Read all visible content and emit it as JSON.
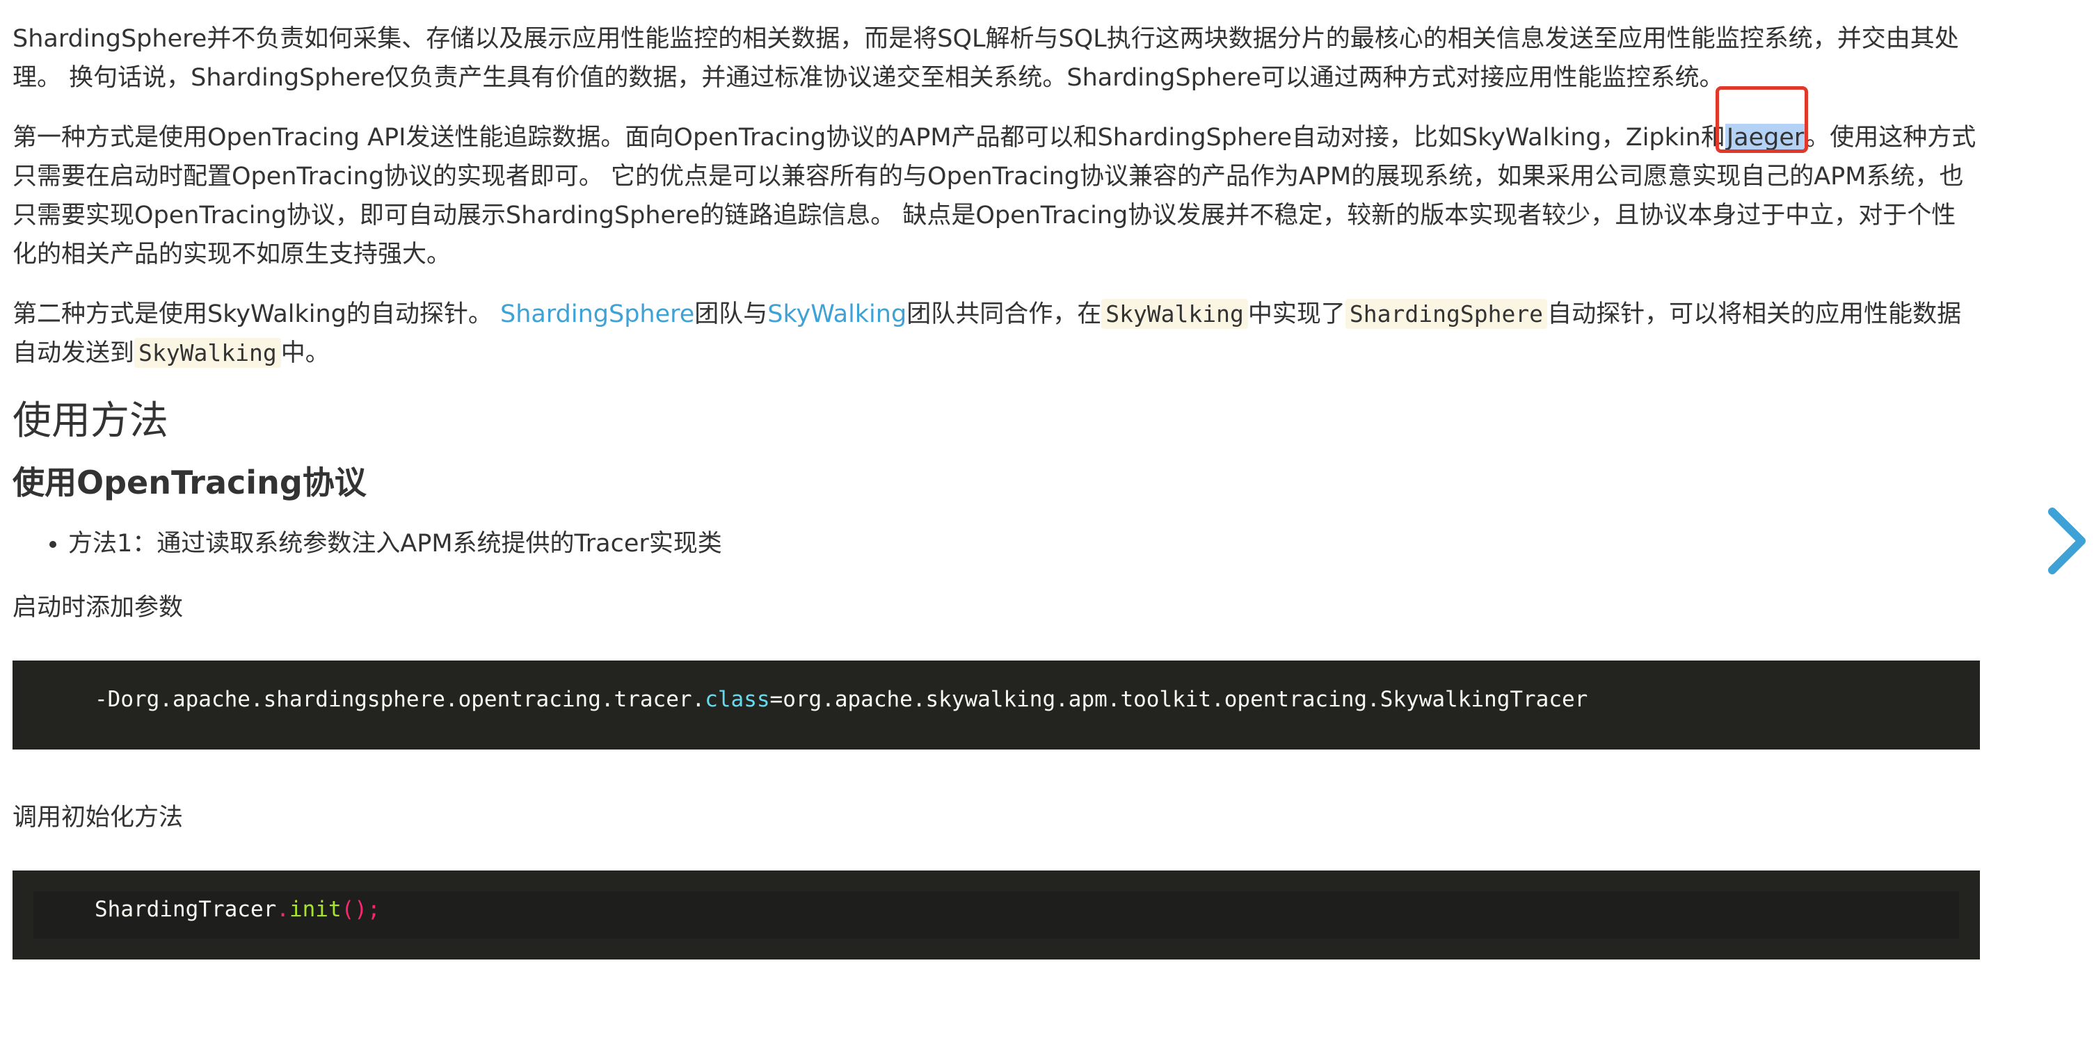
{
  "para1": "ShardingSphere并不负责如何采集、存储以及展示应用性能监控的相关数据，而是将SQL解析与SQL执行这两块数据分片的最核心的相关信息发送至应用性能监控系统，并交由其处理。 换句话说，ShardingSphere仅负责产生具有价值的数据，并通过标准协议递交至相关系统。ShardingSphere可以通过两种方式对接应用性能监控系统。",
  "para2": {
    "before": "第一种方式是使用OpenTracing API发送性能追踪数据。面向OpenTracing协议的APM产品都可以和ShardingSphere自动对接，比如SkyWalking，Zipkin和",
    "selected": "Jaeger",
    "after": "。使用这种方式只需要在启动时配置OpenTracing协议的实现者即可。 它的优点是可以兼容所有的与OpenTracing协议兼容的产品作为APM的展现系统，如果采用公司愿意实现自己的APM系统，也只需要实现OpenTracing协议，即可自动展示ShardingSphere的链路追踪信息。 缺点是OpenTracing协议发展并不稳定，较新的版本实现者较少，且协议本身过于中立，对于个性化的相关产品的实现不如原生支持强大。"
  },
  "para3": {
    "text1": "第二种方式是使用SkyWalking的自动探针。 ",
    "link1": "ShardingSphere",
    "text2": "团队与",
    "link2": "SkyWalking",
    "text3": "团队共同合作，在",
    "code1": "SkyWalking",
    "text4": "中实现了",
    "code2": "ShardingSphere",
    "text5": "自动探针，可以将相关的应用性能数据自动发送到",
    "code3": "SkyWalking",
    "text6": "中。"
  },
  "heading_usage": "使用方法",
  "heading_opentracing": "使用OpenTracing协议",
  "bullet1": "方法1：通过读取系统参数注入APM系统提供的Tracer实现类",
  "label_start_params": "启动时添加参数",
  "code_block1": {
    "part1": "-Dorg.apache.shardingsphere.opentracing.tracer.",
    "keyword": "class",
    "part2": "=org.apache.skywalking.apm.toolkit.opentracing.SkywalkingTracer"
  },
  "label_init_method": "调用初始化方法",
  "code_block2": {
    "obj": "ShardingTracer",
    "dot": ".",
    "method": "init",
    "tail": "();"
  },
  "icons": {
    "next": "chevron-right-icon"
  },
  "colors": {
    "link": "#3fa2d6",
    "code_bg": "#23241f",
    "highlight_box": "#e0392b",
    "selection": "#b3d2f5",
    "arrow": "#3fa2d6"
  }
}
